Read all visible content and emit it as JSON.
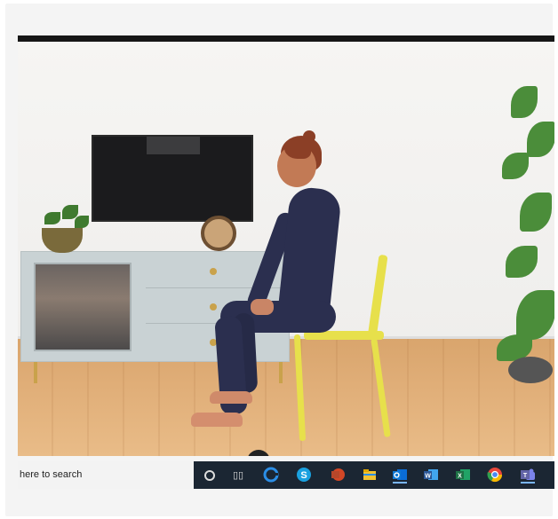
{
  "taskbar": {
    "search_placeholder": "here to search",
    "icons": [
      {
        "name": "cortana-icon"
      },
      {
        "name": "task-view-icon"
      },
      {
        "name": "edge-icon",
        "color": "#2b8ee6"
      },
      {
        "name": "skype-icon",
        "color": "#1aa1e0"
      },
      {
        "name": "powerpoint-icon",
        "color": "#d24726"
      },
      {
        "name": "file-explorer-icon",
        "color": "#f1c232"
      },
      {
        "name": "outlook-icon",
        "color": "#0a6cd6"
      },
      {
        "name": "word-icon",
        "color": "#2b5797"
      },
      {
        "name": "excel-icon",
        "color": "#1e7145"
      },
      {
        "name": "chrome-icon",
        "color": "#e8473b"
      },
      {
        "name": "teams-icon",
        "color": "#6264a7"
      }
    ]
  },
  "colors": {
    "taskbar_bg": "#1b2633",
    "accent_underline": "#7ab6ff",
    "chair_yellow": "#e7e04b",
    "outfit_navy": "#2b2f4f"
  }
}
